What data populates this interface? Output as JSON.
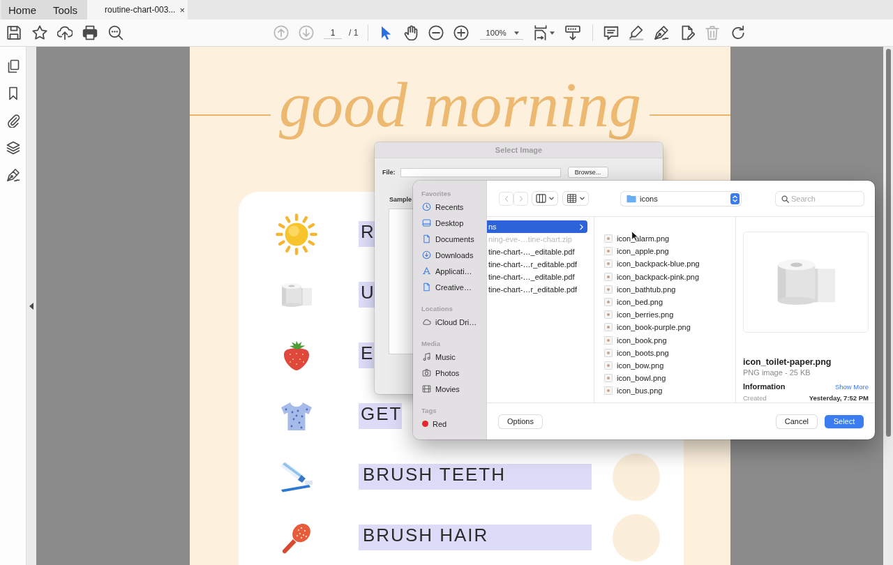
{
  "tabs": [
    {
      "label": "Home",
      "kind": "app",
      "selected": false
    },
    {
      "label": "Tools",
      "kind": "app",
      "selected": false
    },
    {
      "label": "routine-chart-003...",
      "kind": "document",
      "selected": true,
      "close": "×"
    }
  ],
  "toolbar": {
    "page_nav": [
      {
        "disabled": true
      },
      {
        "disabled": true
      }
    ],
    "page_number": "1",
    "page_count": "/ 1",
    "tools": [
      {
        "selected": true
      },
      {
        "selected": false
      }
    ],
    "zoom": "100%",
    "edit_tools": [
      {
        "disabled": false
      },
      {
        "disabled": false
      },
      {
        "disabled": false
      },
      {
        "disabled": false
      },
      {
        "disabled": true
      },
      {
        "disabled": false
      }
    ]
  },
  "document": {
    "title": "good morning",
    "rows": [
      {
        "label": "R",
        "kind": "clipped"
      },
      {
        "label": "U",
        "kind": "clipped"
      },
      {
        "label": "E",
        "kind": "clipped"
      },
      {
        "label": "GET",
        "kind": "clipped"
      },
      {
        "label": "BRUSH TEETH",
        "kind": "full"
      },
      {
        "label": "BRUSH HAIR",
        "kind": "full"
      }
    ]
  },
  "select_image_dialog": {
    "title": "Select Image",
    "file_label": "File:",
    "browse_button": "Browse...",
    "sample_label": "Sample"
  },
  "file_dialog": {
    "sidebar": [
      {
        "heading": "Favorites",
        "items": [
          {
            "label": "Recents",
            "selected": false
          },
          {
            "label": "Desktop",
            "selected": false
          },
          {
            "label": "Documents",
            "selected": false
          },
          {
            "label": "Downloads",
            "selected": false
          },
          {
            "label": "Applicati…",
            "selected": false
          },
          {
            "label": "Creative…",
            "selected": false
          }
        ]
      },
      {
        "heading": "Locations",
        "items": [
          {
            "label": "iCloud Dri…",
            "selected": false
          }
        ]
      },
      {
        "heading": "Media",
        "items": [
          {
            "label": "Music",
            "selected": false
          },
          {
            "label": "Photos",
            "selected": false
          },
          {
            "label": "Movies",
            "selected": false
          }
        ]
      },
      {
        "heading": "Tags",
        "items": [
          {
            "label": "Red",
            "selected": false,
            "color": "#e8262b"
          }
        ]
      }
    ],
    "nav_buttons": [
      {
        "disabled": true
      },
      {
        "disabled": true
      }
    ],
    "location": "icons",
    "search": {
      "placeholder": "Search"
    },
    "columns": [
      {
        "items": [
          {
            "label": "ns",
            "kind": "folder",
            "selected": true,
            "disabled": false
          },
          {
            "label": "ning-eve-…tine-chart.zip",
            "kind": "file",
            "selected": false,
            "disabled": true
          },
          {
            "label": "tine-chart-…_editable.pdf",
            "kind": "file",
            "selected": false,
            "disabled": false
          },
          {
            "label": "tine-chart-…r_editable.pdf",
            "kind": "file",
            "selected": false,
            "disabled": false
          },
          {
            "label": "tine-chart-…_editable.pdf",
            "kind": "file",
            "selected": false,
            "disabled": false
          },
          {
            "label": "tine-chart-…r_editable.pdf",
            "kind": "file",
            "selected": false,
            "disabled": false
          }
        ]
      },
      {
        "items": [
          {
            "label": "icon_alarm.png",
            "selected": false
          },
          {
            "label": "icon_apple.png",
            "selected": false
          },
          {
            "label": "icon_backpack-blue.png",
            "selected": false
          },
          {
            "label": "icon_backpack-pink.png",
            "selected": false
          },
          {
            "label": "icon_bathtub.png",
            "selected": false
          },
          {
            "label": "icon_bed.png",
            "selected": false
          },
          {
            "label": "icon_berries.png",
            "selected": false
          },
          {
            "label": "icon_book-purple.png",
            "selected": false
          },
          {
            "label": "icon_book.png",
            "selected": false
          },
          {
            "label": "icon_boots.png",
            "selected": false
          },
          {
            "label": "icon_bow.png",
            "selected": false
          },
          {
            "label": "icon_bowl.png",
            "selected": false
          },
          {
            "label": "icon_bus.png",
            "selected": false
          }
        ]
      }
    ],
    "preview": {
      "name": "icon_toilet-paper.png",
      "type": "PNG image - 25 KB",
      "info_heading": "Information",
      "show_more": "Show More",
      "created_label": "Created",
      "created_value": "Yesterday, 7:52 PM"
    },
    "options_button": "Options",
    "buttons": [
      {
        "label": "Cancel",
        "primary": false
      },
      {
        "label": "Select",
        "primary": true
      }
    ]
  }
}
